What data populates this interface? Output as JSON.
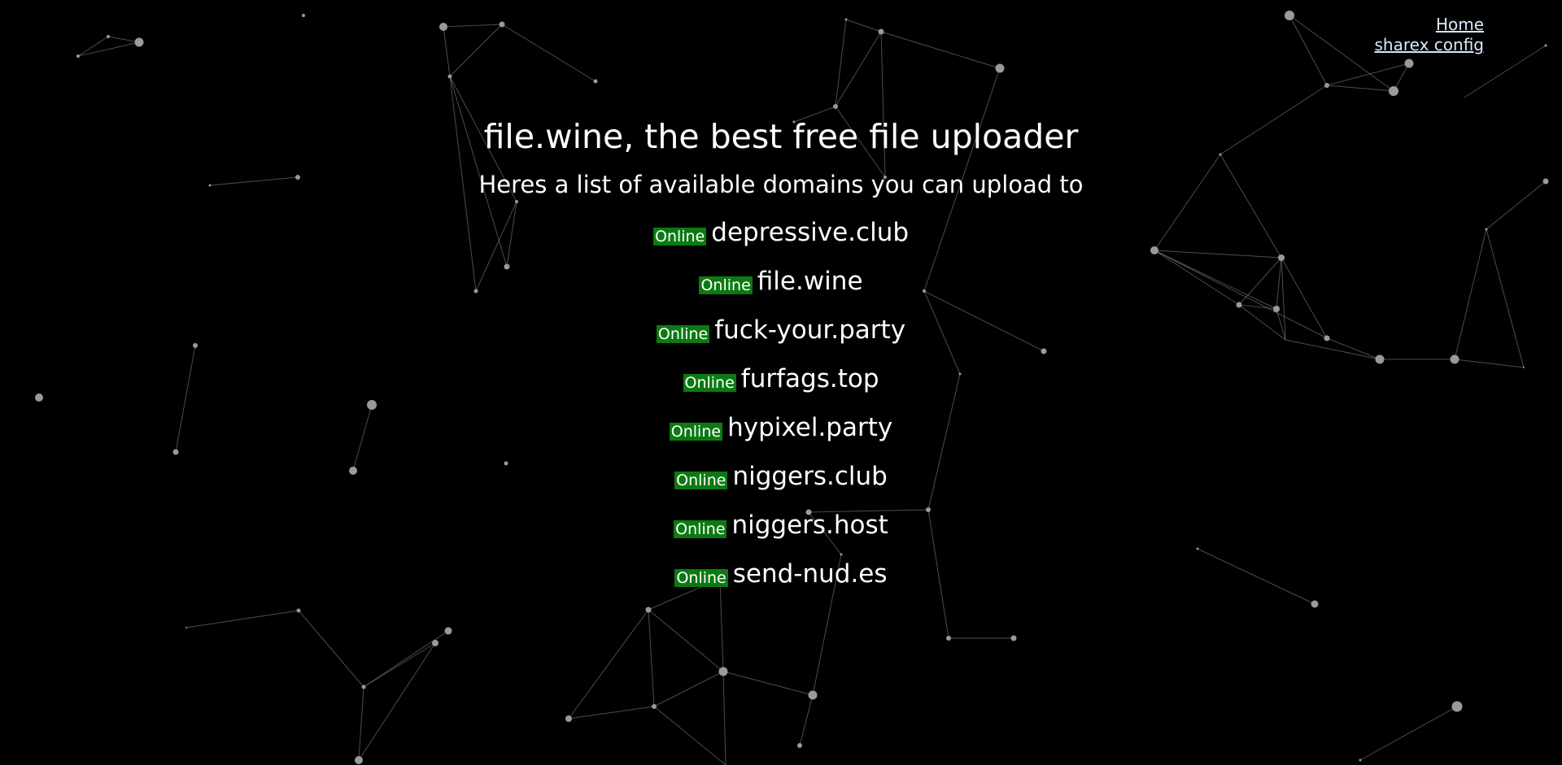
{
  "nav": {
    "home_label": "Home",
    "sharex_label": "sharex config",
    "link_color": "#d8e8ff"
  },
  "header": {
    "title": "file.wine, the best free file uploader",
    "subtitle": "Heres a list of available domains you can upload to"
  },
  "colors": {
    "background": "#000000",
    "online_badge": "#0b7a12",
    "network_lines": "#8a8a8a"
  },
  "domains": [
    {
      "status": "Online",
      "name": "depressive.club"
    },
    {
      "status": "Online",
      "name": "file.wine"
    },
    {
      "status": "Online",
      "name": "fuck-your.party"
    },
    {
      "status": "Online",
      "name": "furfags.top"
    },
    {
      "status": "Online",
      "name": "hypixel.party"
    },
    {
      "status": "Online",
      "name": "niggers.club"
    },
    {
      "status": "Online",
      "name": "niggers.host"
    },
    {
      "status": "Online",
      "name": "send-nud.es"
    }
  ]
}
